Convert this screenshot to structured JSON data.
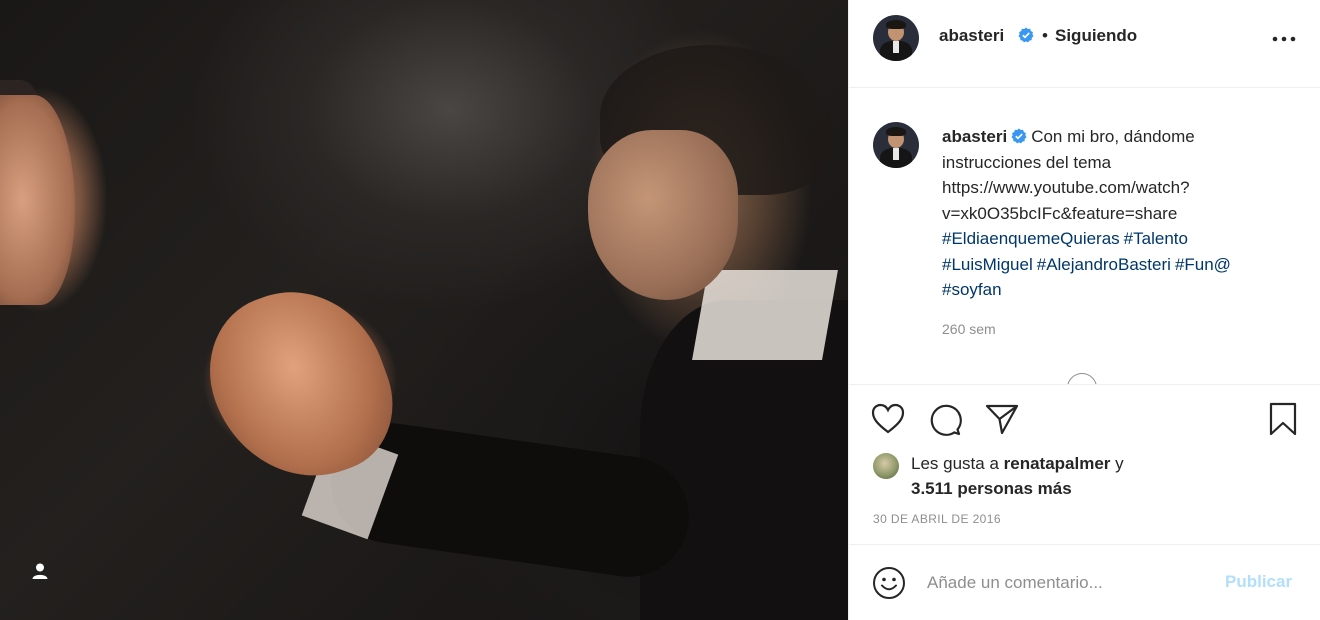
{
  "post": {
    "image": {
      "tag_icon": "user-tag-icon"
    },
    "header": {
      "username": "abasteri",
      "verified_icon": "verified-badge-icon",
      "separator": "•",
      "follow_status": "Siguiendo",
      "more_icon": "more-options-icon"
    },
    "caption": {
      "username": "abasteri",
      "text": "Con mi bro, dándome instrucciones del tema",
      "link": "https://www.youtube.com/watch?v=xk0O35bcIFc&feature=share",
      "hashtags": [
        "#EldiaenquemeQuieras",
        "#Talento",
        "#LuisMiguel",
        "#AlejandroBasteri",
        "#Fun@",
        "#soyfan"
      ],
      "time_ago": "260 sem"
    },
    "actions": {
      "like_icon": "heart-icon",
      "comment_icon": "comment-icon",
      "share_icon": "paper-plane-icon",
      "save_icon": "bookmark-icon"
    },
    "likes": {
      "prefix": "Les gusta a",
      "user": "renatapalmer",
      "connector": "y",
      "others": "3.511 personas más"
    },
    "date": "30 DE ABRIL DE 2016",
    "comment_box": {
      "emoji_icon": "emoji-icon",
      "placeholder": "Añade un comentario...",
      "publish_label": "Publicar"
    },
    "colors": {
      "text": "#262626",
      "hashtag": "#00376b",
      "verified": "#3897f0",
      "muted": "#8e8e8e",
      "publish_disabled": "#b2dffc"
    }
  }
}
